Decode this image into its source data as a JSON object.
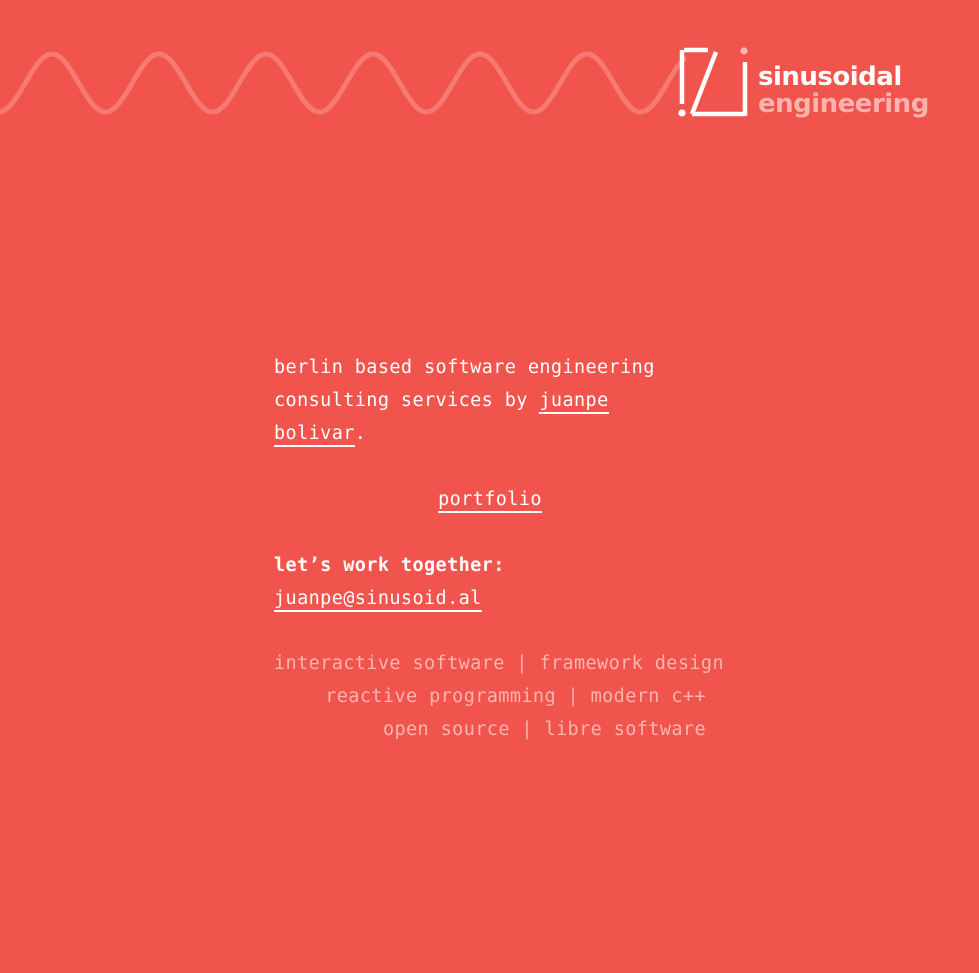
{
  "logo": {
    "line1": "sinusoidal",
    "line2": "engineering",
    "icon": "sinusoid-logo-icon"
  },
  "intro": {
    "line1": "berlin based software engineering",
    "line2_prefix": "consulting services by ",
    "author_link": "juanpe bolivar",
    "line2_suffix": "."
  },
  "portfolio_link": "portfolio",
  "contact": {
    "label": "let’s work together:",
    "email": "juanpe@sinusoid.al"
  },
  "tags": [
    "interactive software | framework design",
    "reactive programming | modern c++",
    "open source | libre software"
  ],
  "colors": {
    "background": "#f1544c",
    "wave": "#f77a72",
    "muted_text": "#fbb4ae",
    "text": "#ffffff"
  }
}
